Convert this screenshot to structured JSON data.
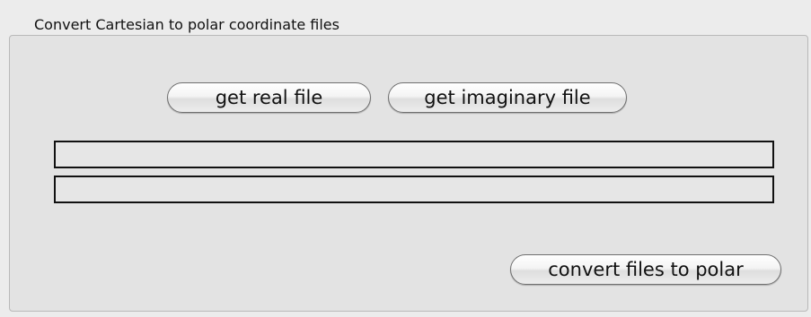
{
  "group": {
    "title": "Convert Cartesian to polar coordinate files"
  },
  "buttons": {
    "get_real_label": "get real file",
    "get_imaginary_label": "get imaginary file",
    "convert_label": "convert files to polar"
  },
  "fields": {
    "real_file_path": "",
    "imaginary_file_path": ""
  }
}
